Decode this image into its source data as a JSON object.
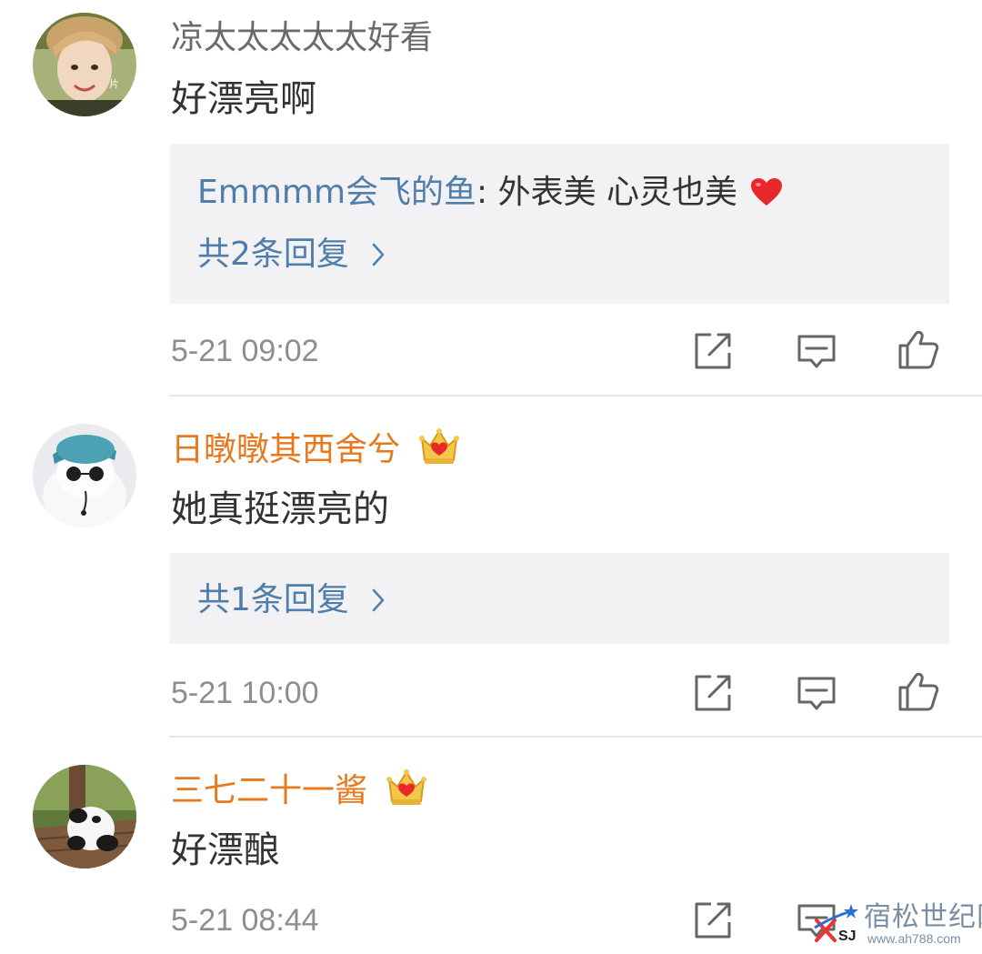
{
  "comments": [
    {
      "username": "凉太太太太太好看",
      "content": "好漂亮啊",
      "reply_preview": {
        "author": "Emmmm会飞的鱼",
        "separator": ": ",
        "text": "外表美  心灵也美"
      },
      "reply_count_label": "共2条回复",
      "time": "5-21 09:02",
      "avatar_icon": "user-avatar-photo"
    },
    {
      "username": "日暾暾其西舍兮",
      "content": "她真挺漂亮的",
      "reply_count_label": "共1条回复",
      "time": "5-21 10:00",
      "avatar_icon": "cat-with-cap-avatar"
    },
    {
      "username": "三七二十一酱",
      "content": "好漂酿",
      "time": "5-21 08:44",
      "avatar_icon": "panda-avatar"
    }
  ],
  "watermark": {
    "text": "宿松世纪网",
    "url": "www.ah788.com",
    "logo_text": "SJ"
  },
  "colors": {
    "vip_name": "#e8781c",
    "reply_author": "#4f7eaa",
    "reply_bg": "#f2f2f5",
    "crown_gold": "#f3c84a",
    "heart": "#e8282b"
  }
}
